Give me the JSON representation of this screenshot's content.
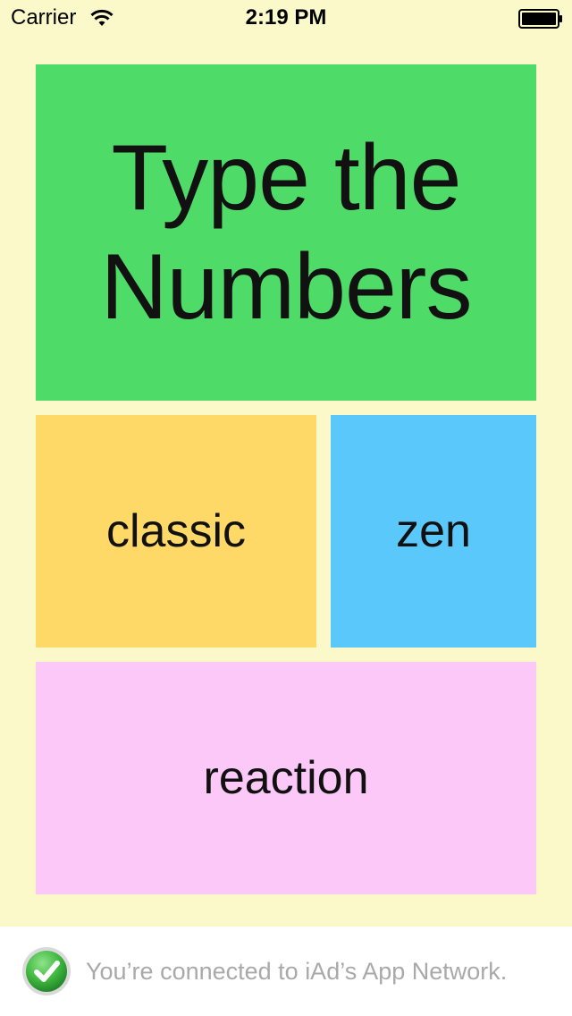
{
  "status_bar": {
    "carrier": "Carrier",
    "time": "2:19 PM",
    "wifi_icon": "wifi-icon",
    "battery_icon": "battery-full-icon"
  },
  "title": {
    "text": "Type the\nNumbers",
    "color": "#4fdb68"
  },
  "modes": {
    "classic": {
      "label": "classic",
      "color": "#fed968"
    },
    "zen": {
      "label": "zen",
      "color": "#5bc8fb"
    },
    "reaction": {
      "label": "reaction",
      "color": "#fbc8f8"
    }
  },
  "ad_banner": {
    "icon": "checkmark-icon",
    "text": "You’re connected to iAd’s App Network."
  },
  "colors": {
    "background": "#fbf8c9",
    "ad_text": "#a9a9a9",
    "check_green": "#3fb83f"
  }
}
